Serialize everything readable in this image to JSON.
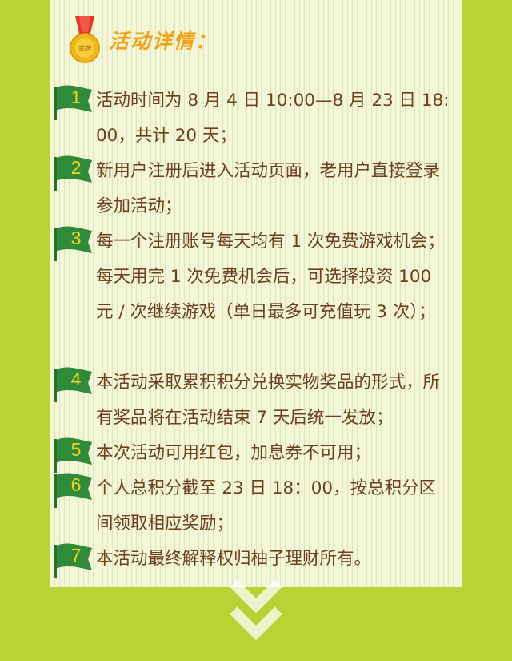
{
  "header": {
    "medal_text": "金牌",
    "title": "活动详情："
  },
  "items": [
    {
      "number": "1",
      "text": "活动时间为 8 月 4 日 10:00—8 月 23 日 18:00，共计 20 天；"
    },
    {
      "number": "2",
      "text": "新用户注册后进入活动页面，老用户直接登录参加活动；"
    },
    {
      "number": "3",
      "text": "每一个注册账号每天均有 1 次免费游戏机会；每天用完 1 次免费机会后，可选择投资 100 元 / 次继续游戏（单日最多可充值玩 3 次）；"
    },
    {
      "number": "4",
      "text": "本活动采取累积积分兑换实物奖品的形式，所有奖品将在活动结束 7 天后统一发放；"
    },
    {
      "number": "5",
      "text": "本次活动可用红包，加息券不可用；"
    },
    {
      "number": "6",
      "text": "个人总积分截至 23 日 18：00，按总积分区间领取相应奖励；"
    },
    {
      "number": "7",
      "text": "本活动最终解释权归柚子理财所有。"
    }
  ],
  "colors": {
    "background": "#b8d434",
    "card": "#f3f6d8",
    "text": "#6e4020",
    "flag": "#2f8a3a",
    "flag_number": "#f4d21e",
    "title": "#f0a318"
  }
}
